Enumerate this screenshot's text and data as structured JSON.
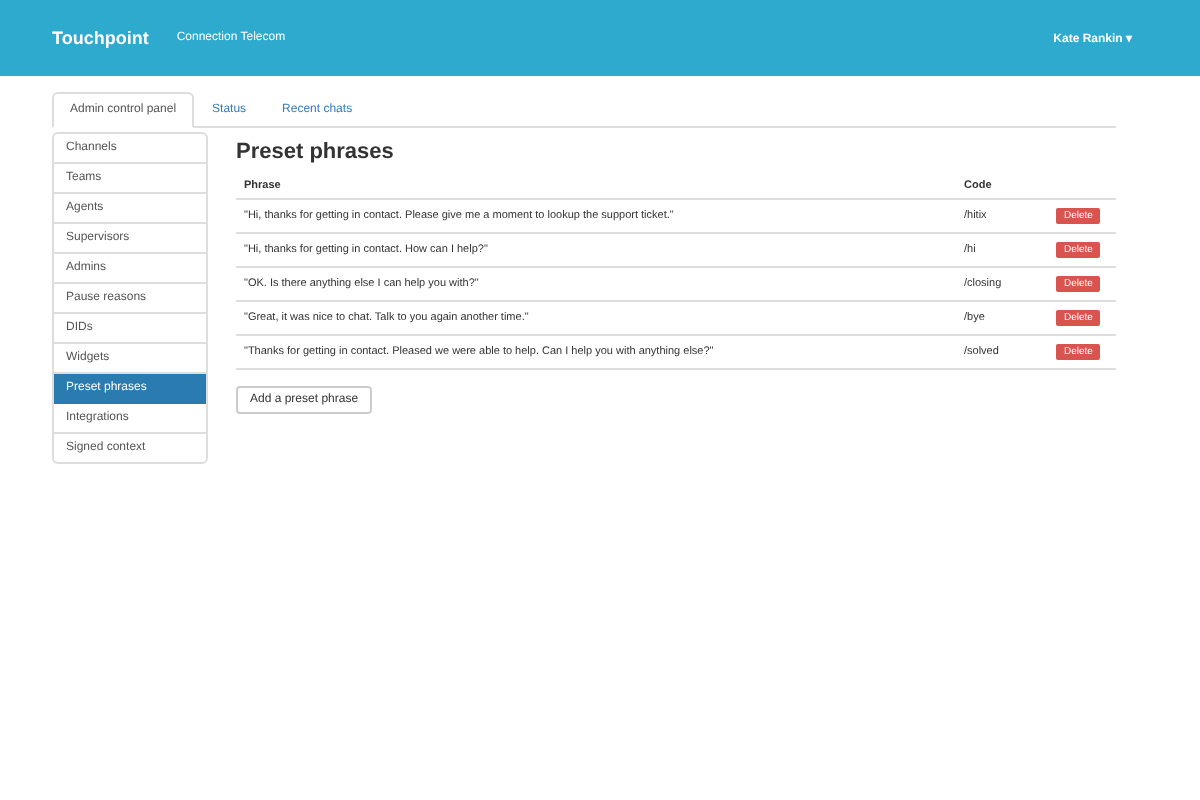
{
  "navbar": {
    "brand": "Touchpoint",
    "company": "Connection Telecom",
    "user": "Kate Rankin",
    "user_caret": "▾"
  },
  "tabs": [
    {
      "label": "Admin control panel",
      "selected": true
    },
    {
      "label": "Status",
      "selected": false
    },
    {
      "label": "Recent chats",
      "selected": false
    }
  ],
  "sidebar": {
    "items": [
      {
        "label": "Channels",
        "selected": false
      },
      {
        "label": "Teams",
        "selected": false
      },
      {
        "label": "Agents",
        "selected": false
      },
      {
        "label": "Supervisors",
        "selected": false
      },
      {
        "label": "Admins",
        "selected": false
      },
      {
        "label": "Pause reasons",
        "selected": false
      },
      {
        "label": "DIDs",
        "selected": false
      },
      {
        "label": "Widgets",
        "selected": false
      },
      {
        "label": "Preset phrases",
        "selected": true
      },
      {
        "label": "Integrations",
        "selected": false
      },
      {
        "label": "Signed context",
        "selected": false
      }
    ]
  },
  "content": {
    "title": "Preset phrases",
    "table": {
      "columns": [
        "Phrase",
        "Code"
      ],
      "rows": [
        {
          "phrase": "\"Hi, thanks for getting in contact. Please give me a moment to lookup the support ticket.\"",
          "code": "/hitix",
          "action": "Delete"
        },
        {
          "phrase": "\"Hi, thanks for getting in contact. How can I help?\"",
          "code": "/hi",
          "action": "Delete"
        },
        {
          "phrase": "\"OK. Is there anything else I can help you with?\"",
          "code": "/closing",
          "action": "Delete"
        },
        {
          "phrase": "\"Great, it was nice to chat. Talk to you again another time.\"",
          "code": "/bye",
          "action": "Delete"
        },
        {
          "phrase": "\"Thanks for getting in contact. Pleased we were able to help. Can I help you with anything else?\"",
          "code": "/solved",
          "action": "Delete"
        }
      ]
    },
    "add_button": "Add a preset phrase"
  }
}
